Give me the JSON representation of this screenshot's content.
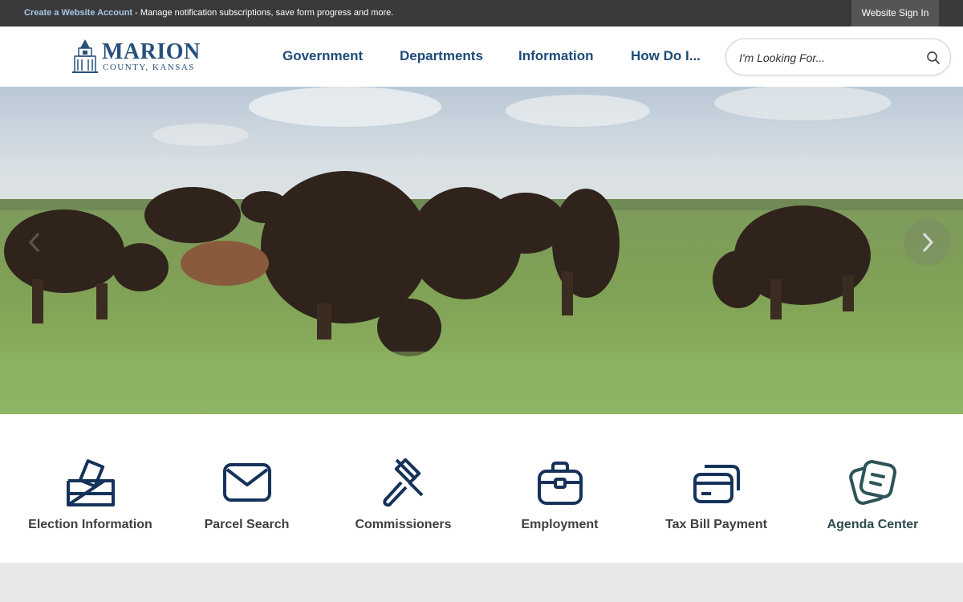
{
  "topbar": {
    "create_account_link": "Create a Website Account",
    "message": " - Manage notification subscriptions, save form progress and more.",
    "sign_in_label": "Website Sign In"
  },
  "logo": {
    "title": "MARION",
    "subtitle": "COUNTY, KANSAS"
  },
  "nav": {
    "items": [
      {
        "label": "Government"
      },
      {
        "label": "Departments"
      },
      {
        "label": "Information"
      },
      {
        "label": "How Do I..."
      }
    ]
  },
  "search": {
    "placeholder": "I'm Looking For...",
    "icon": "search-icon"
  },
  "hero": {
    "icons": {
      "prev": "chevron-left-icon",
      "next": "chevron-right-icon"
    }
  },
  "quick_links": [
    {
      "label": "Election Information",
      "icon": "ballot-box-icon"
    },
    {
      "label": "Parcel Search",
      "icon": "envelope-icon"
    },
    {
      "label": "Commissioners",
      "icon": "gavel-icon"
    },
    {
      "label": "Employment",
      "icon": "briefcase-icon"
    },
    {
      "label": "Tax Bill Payment",
      "icon": "credit-card-icon"
    },
    {
      "label": "Agenda Center",
      "icon": "notes-icon"
    }
  ],
  "colors": {
    "topbar": "#3a3a3a",
    "nav_text": "#1e4a78",
    "icon_navy": "#15325a",
    "icon_teal": "#2d5358",
    "footer_band": "#e9e8e8"
  }
}
